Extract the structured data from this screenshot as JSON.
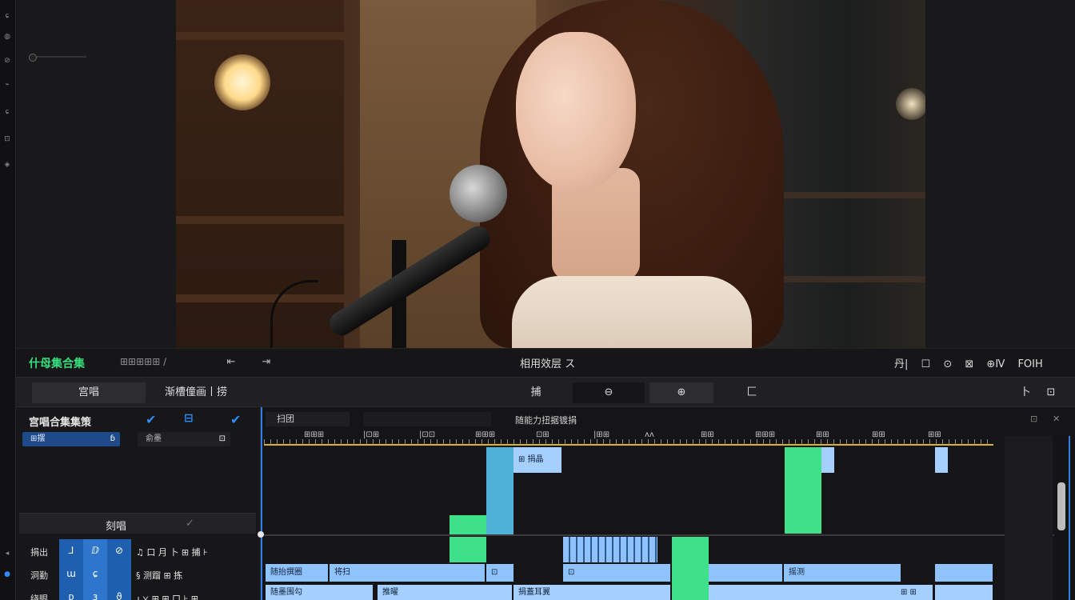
{
  "project": {
    "name": "什母集合集",
    "timecode": "⊞⊞⊞⊞⊞ ∕"
  },
  "transport": {
    "btn_prev": "⇤",
    "btn_next": "⇥",
    "center_label": "相用效层",
    "center_mark": "ス",
    "right_items": [
      "丹|",
      "☐",
      "⊙",
      "⊠",
      "⊕Ⅳ",
      "FOIH"
    ]
  },
  "tabs": {
    "tab1": "宫唱",
    "tab2": "渐槽僮画丨捞",
    "tab3": "捕",
    "tab4": "⊖",
    "tab5": "⊕",
    "tab6": "匚",
    "tab_right1": "卜",
    "tab_right2": "⊡"
  },
  "left_panel": {
    "title": "宫唱合集集策",
    "field1": "⊞摆",
    "field1_icon": "ɓ",
    "field2": "俞墨",
    "field2_icon": "⊡",
    "section_label": "刻唱",
    "section_check": "✓",
    "rows": [
      {
        "label": "捐出",
        "icons": [
          "⅃",
          "ⅅ",
          "⊘"
        ],
        "extra": "♫ 口 月 卜 ⊞ 捕 ⊦"
      },
      {
        "label": "洞勤",
        "icons": [
          "ɯ",
          "ɕ",
          ""
        ],
        "extra": "§   测蹓  ⊞ 拣"
      },
      {
        "label": "绕眼",
        "icons": [
          "ᴅ",
          "ɜ",
          "ϑ"
        ],
        "extra": "ɻ ⋎ ⊞ ⊞ 口 ⊦ ⊞"
      }
    ]
  },
  "timeline": {
    "track_name": "扫团",
    "header_center": "随能力扭据镀捐",
    "ruler_labels": [
      "⊞⊞⊞",
      "|⊡⊞",
      "|⊡⊡",
      "⊞⊞⊞",
      "⊡⊞",
      "|⊞⊞",
      "ᴧᴧ",
      "⊞⊞",
      "⊞⊞⊞",
      "⊞⊞",
      "⊞⊞",
      "⊞⊞"
    ],
    "clips_top": [
      {
        "label": ""
      },
      {
        "label": "⊞ 捐晶"
      },
      {
        "label": ""
      },
      {
        "label": ""
      }
    ],
    "clips_bottom1": [
      "随抬撰圈",
      "将扫",
      "⊡",
      "⊡",
      "摇测",
      ""
    ],
    "clips_bottom2": [
      "随墨围勾",
      "推曜",
      "捐蓋耳翼",
      "⊞ ⊞"
    ]
  },
  "rail_icons": [
    "ɕ",
    "◍",
    "⊘",
    "⌁",
    "ɕ",
    "⊡",
    "◈"
  ]
}
